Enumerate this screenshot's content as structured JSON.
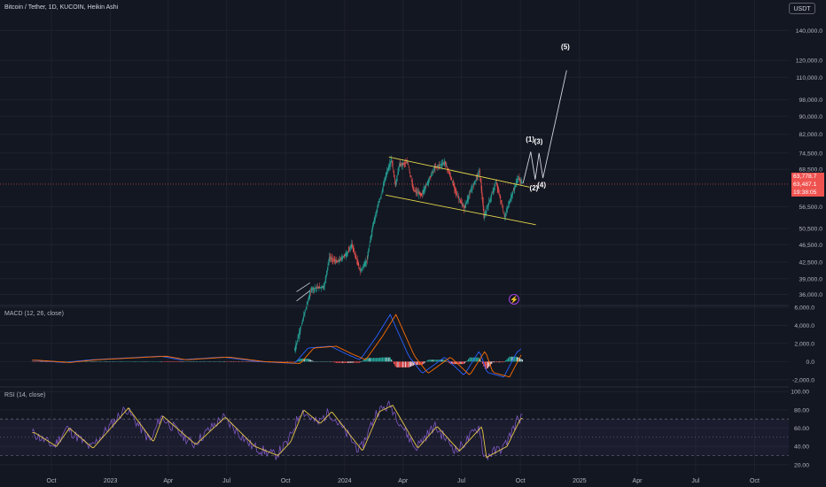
{
  "header": {
    "symbol": "Bitcoin / Tether",
    "interval": "1D",
    "exchange": "KUCOIN",
    "chart_style": "Heikin Ashi",
    "title_line": "Bitcoin / Tether, 1D, KUCOIN, Heikin Ashi",
    "currency": "USDT"
  },
  "price_tags": {
    "heikin_close": "63,778.7",
    "last_price": "63,487.1",
    "countdown": "19:38:05"
  },
  "indicators": {
    "macd_label": "MACD (12, 26, close)",
    "rsi_label": "RSI (14, close)"
  },
  "colors": {
    "background": "#131722",
    "up": "#26a69a",
    "down": "#ef5350",
    "channel": "#e6d84a",
    "projection": "#d1d4dc",
    "macd_line": "#2962ff",
    "signal_line": "#ff6d00",
    "rsi_line": "#7e57c2",
    "rsi_ma": "#e6c84a"
  },
  "chart_data": [
    {
      "type": "candlestick",
      "title": "Bitcoin / Tether, 1D, KUCOIN, Heikin Ashi",
      "scale": "log",
      "ylim": [
        34000,
        160000
      ],
      "y_ticks": [
        "140,000.0",
        "120,000.0",
        "110,000.0",
        "98,000.0",
        "90,000.0",
        "82,000.0",
        "74,500.0",
        "68,500.0",
        "56,500.0",
        "50,500.0",
        "46,500.0",
        "42,500.0",
        "39,000.0",
        "36,000.0"
      ],
      "x_ticks": [
        "Oct",
        "2023",
        "Apr",
        "Jul",
        "Oct",
        "2024",
        "Apr",
        "Jul",
        "Oct",
        "2025",
        "Apr",
        "Jul",
        "Oct"
      ],
      "x_tick_dates": [
        "2022-10-01",
        "2023-01-01",
        "2023-04-01",
        "2023-07-01",
        "2023-10-01",
        "2024-01-01",
        "2024-04-01",
        "2024-07-01",
        "2024-10-01",
        "2025-01-01",
        "2025-04-01",
        "2025-07-01",
        "2025-10-01"
      ],
      "price_path": [
        [
          "2023-10-15",
          27000
        ],
        [
          "2023-10-25",
          30500
        ],
        [
          "2023-11-10",
          37000
        ],
        [
          "2023-11-30",
          37500
        ],
        [
          "2023-12-08",
          43500
        ],
        [
          "2023-12-20",
          42500
        ],
        [
          "2024-01-05",
          44500
        ],
        [
          "2024-01-12",
          46500
        ],
        [
          "2024-01-25",
          40500
        ],
        [
          "2024-02-05",
          43000
        ],
        [
          "2024-02-14",
          51500
        ],
        [
          "2024-02-28",
          61000
        ],
        [
          "2024-03-05",
          66500
        ],
        [
          "2024-03-14",
          72000
        ],
        [
          "2024-03-20",
          63000
        ],
        [
          "2024-03-26",
          70000
        ],
        [
          "2024-04-08",
          71000
        ],
        [
          "2024-04-17",
          61500
        ],
        [
          "2024-04-30",
          60000
        ],
        [
          "2024-05-20",
          69000
        ],
        [
          "2024-06-05",
          71000
        ],
        [
          "2024-06-24",
          60000
        ],
        [
          "2024-07-05",
          56000
        ],
        [
          "2024-07-29",
          68000
        ],
        [
          "2024-08-05",
          53500
        ],
        [
          "2024-08-24",
          64000
        ],
        [
          "2024-09-06",
          53500
        ],
        [
          "2024-09-27",
          65500
        ],
        [
          "2024-10-04",
          63800
        ]
      ],
      "channel": {
        "upper": [
          [
            "2024-03-10",
            73000
          ],
          [
            "2024-10-15",
            62500
          ]
        ],
        "lower": [
          [
            "2024-03-05",
            60000
          ],
          [
            "2024-10-25",
            51500
          ]
        ]
      },
      "small_channel": {
        "upper": [
          [
            "2023-10-18",
            36500
          ],
          [
            "2023-11-08",
            38200
          ]
        ],
        "lower": [
          [
            "2023-10-18",
            34800
          ],
          [
            "2023-11-08",
            36700
          ]
        ]
      },
      "wave_projection": {
        "path": [
          [
            "2024-10-05",
            63800
          ],
          [
            "2024-10-17",
            75000
          ],
          [
            "2024-10-24",
            65000
          ],
          [
            "2024-10-30",
            74500
          ],
          [
            "2024-11-05",
            65500
          ],
          [
            "2024-12-12",
            114000
          ]
        ],
        "labels": [
          {
            "text": "(1)",
            "date": "2024-10-16",
            "price": 79000
          },
          {
            "text": "(2)",
            "date": "2024-10-22",
            "price": 61500
          },
          {
            "text": "(3)",
            "date": "2024-10-29",
            "price": 78000
          },
          {
            "text": "(4)",
            "date": "2024-11-03",
            "price": 62500
          },
          {
            "text": "(5)",
            "date": "2024-12-10",
            "price": 127000
          }
        ]
      }
    },
    {
      "type": "histogram",
      "title": "MACD (12, 26, close)",
      "ylim": [
        -2800,
        6200
      ],
      "y_ticks": [
        "6,000.0",
        "4,000.0",
        "2,000.0",
        "0.0",
        "-2,000.0"
      ],
      "macd_path": [
        [
          "2022-09-01",
          150
        ],
        [
          "2022-10-20",
          -100
        ],
        [
          "2022-12-01",
          200
        ],
        [
          "2023-01-25",
          400
        ],
        [
          "2023-03-20",
          600
        ],
        [
          "2023-04-20",
          200
        ],
        [
          "2023-06-25",
          500
        ],
        [
          "2023-08-20",
          0
        ],
        [
          "2023-10-15",
          -200
        ],
        [
          "2023-11-05",
          1500
        ],
        [
          "2023-12-10",
          1700
        ],
        [
          "2024-01-05",
          800
        ],
        [
          "2024-01-25",
          200
        ],
        [
          "2024-02-20",
          2800
        ],
        [
          "2024-03-12",
          5200
        ],
        [
          "2024-04-10",
          600
        ],
        [
          "2024-05-01",
          -1300
        ],
        [
          "2024-06-05",
          500
        ],
        [
          "2024-07-05",
          -1500
        ],
        [
          "2024-07-29",
          1200
        ],
        [
          "2024-08-10",
          -1200
        ],
        [
          "2024-09-05",
          -1700
        ],
        [
          "2024-09-25",
          1000
        ],
        [
          "2024-10-04",
          1500
        ]
      ]
    },
    {
      "type": "line",
      "title": "RSI (14, close)",
      "ylim": [
        15,
        105
      ],
      "y_ticks": [
        "100.00",
        "80.00",
        "60.00",
        "40.00",
        "20.00"
      ],
      "bands": [
        30,
        50,
        70
      ],
      "rsi_path": [
        [
          "2022-09-01",
          55
        ],
        [
          "2022-10-05",
          40
        ],
        [
          "2022-10-25",
          60
        ],
        [
          "2022-12-01",
          38
        ],
        [
          "2023-01-25",
          82
        ],
        [
          "2023-03-05",
          45
        ],
        [
          "2023-03-20",
          73
        ],
        [
          "2023-05-10",
          42
        ],
        [
          "2023-06-25",
          72
        ],
        [
          "2023-08-10",
          40
        ],
        [
          "2023-09-15",
          30
        ],
        [
          "2023-10-05",
          45
        ],
        [
          "2023-10-25",
          80
        ],
        [
          "2023-11-20",
          65
        ],
        [
          "2023-12-08",
          78
        ],
        [
          "2024-01-25",
          35
        ],
        [
          "2024-02-20",
          78
        ],
        [
          "2024-03-12",
          85
        ],
        [
          "2024-04-20",
          38
        ],
        [
          "2024-05-20",
          62
        ],
        [
          "2024-06-24",
          35
        ],
        [
          "2024-07-29",
          62
        ],
        [
          "2024-08-05",
          28
        ],
        [
          "2024-09-06",
          40
        ],
        [
          "2024-09-27",
          70
        ],
        [
          "2024-10-04",
          72
        ]
      ]
    }
  ]
}
